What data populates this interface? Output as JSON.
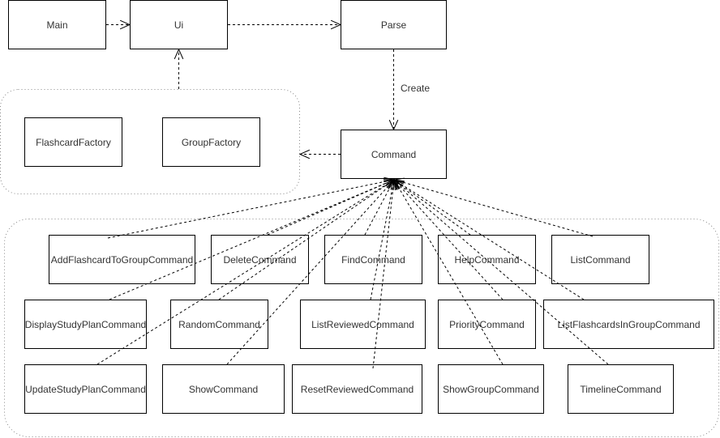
{
  "diagram": {
    "type": "class-dependency-diagram",
    "nodes": {
      "main": "Main",
      "ui": "Ui",
      "parse": "Parse",
      "command": "Command",
      "flashcard_factory": "FlashcardFactory",
      "group_factory": "GroupFactory",
      "add_flashcard_to_group": "AddFlashcardToGroupCommand",
      "delete": "DeleteCommand",
      "find": "FindCommand",
      "help": "HelpCommand",
      "list": "ListCommand",
      "display_study_plan": "DisplayStudyPlanCommand",
      "random": "RandomCommand",
      "list_reviewed": "ListReviewedCommand",
      "priority": "PriorityCommand",
      "list_flashcards_in_group": "ListFlashcardsInGroupCommand",
      "update_study_plan": "UpdateStudyPlanCommand",
      "show": "ShowCommand",
      "reset_reviewed": "ResetReviewedCommand",
      "show_group": "ShowGroupCommand",
      "timeline": "TimelineCommand"
    },
    "groups": {
      "factories": [
        "FlashcardFactory",
        "GroupFactory"
      ],
      "commands": [
        "AddFlashcardToGroupCommand",
        "DeleteCommand",
        "FindCommand",
        "HelpCommand",
        "ListCommand",
        "DisplayStudyPlanCommand",
        "RandomCommand",
        "ListReviewedCommand",
        "PriorityCommand",
        "ListFlashcardsInGroupCommand",
        "UpdateStudyPlanCommand",
        "ShowCommand",
        "ResetReviewedCommand",
        "ShowGroupCommand",
        "TimelineCommand"
      ]
    },
    "edge_labels": {
      "parse_to_command": "Create"
    },
    "edges": [
      {
        "from": "Main",
        "to": "Ui",
        "style": "dashed-open-arrow"
      },
      {
        "from": "Ui",
        "to": "Parse",
        "style": "dashed-open-arrow"
      },
      {
        "from": "Parse",
        "to": "Command",
        "style": "dashed-open-arrow",
        "label": "Create"
      },
      {
        "from": "Factories group",
        "to": "Ui",
        "style": "dashed-open-arrow"
      },
      {
        "from": "Command",
        "to": "Factories group",
        "style": "dashed-open-arrow"
      },
      {
        "from": "Each command",
        "to": "Command",
        "style": "dashed-open-arrow"
      }
    ]
  }
}
